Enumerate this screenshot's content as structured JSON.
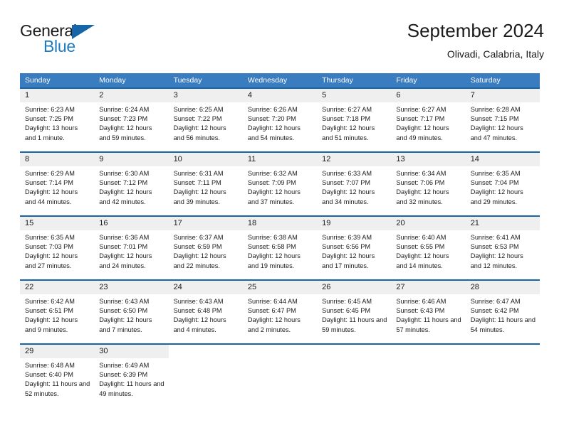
{
  "brand": {
    "name_part1": "General",
    "name_part2": "Blue",
    "logo_icon": "triangle-logo-icon",
    "accent_color": "#1565a8"
  },
  "header": {
    "title": "September 2024",
    "subtitle": "Olivadi, Calabria, Italy"
  },
  "colors": {
    "header_bar": "#3a7cc0",
    "cell_border_top": "#1565a8",
    "daynum_band": "#efefef",
    "text": "#1b1b1b",
    "brand_blue": "#1f7ac0"
  },
  "weekdays": [
    "Sunday",
    "Monday",
    "Tuesday",
    "Wednesday",
    "Thursday",
    "Friday",
    "Saturday"
  ],
  "weeks": [
    [
      {
        "day": "1",
        "sunrise": "Sunrise: 6:23 AM",
        "sunset": "Sunset: 7:25 PM",
        "daylight": "Daylight: 13 hours and 1 minute."
      },
      {
        "day": "2",
        "sunrise": "Sunrise: 6:24 AM",
        "sunset": "Sunset: 7:23 PM",
        "daylight": "Daylight: 12 hours and 59 minutes."
      },
      {
        "day": "3",
        "sunrise": "Sunrise: 6:25 AM",
        "sunset": "Sunset: 7:22 PM",
        "daylight": "Daylight: 12 hours and 56 minutes."
      },
      {
        "day": "4",
        "sunrise": "Sunrise: 6:26 AM",
        "sunset": "Sunset: 7:20 PM",
        "daylight": "Daylight: 12 hours and 54 minutes."
      },
      {
        "day": "5",
        "sunrise": "Sunrise: 6:27 AM",
        "sunset": "Sunset: 7:18 PM",
        "daylight": "Daylight: 12 hours and 51 minutes."
      },
      {
        "day": "6",
        "sunrise": "Sunrise: 6:27 AM",
        "sunset": "Sunset: 7:17 PM",
        "daylight": "Daylight: 12 hours and 49 minutes."
      },
      {
        "day": "7",
        "sunrise": "Sunrise: 6:28 AM",
        "sunset": "Sunset: 7:15 PM",
        "daylight": "Daylight: 12 hours and 47 minutes."
      }
    ],
    [
      {
        "day": "8",
        "sunrise": "Sunrise: 6:29 AM",
        "sunset": "Sunset: 7:14 PM",
        "daylight": "Daylight: 12 hours and 44 minutes."
      },
      {
        "day": "9",
        "sunrise": "Sunrise: 6:30 AM",
        "sunset": "Sunset: 7:12 PM",
        "daylight": "Daylight: 12 hours and 42 minutes."
      },
      {
        "day": "10",
        "sunrise": "Sunrise: 6:31 AM",
        "sunset": "Sunset: 7:11 PM",
        "daylight": "Daylight: 12 hours and 39 minutes."
      },
      {
        "day": "11",
        "sunrise": "Sunrise: 6:32 AM",
        "sunset": "Sunset: 7:09 PM",
        "daylight": "Daylight: 12 hours and 37 minutes."
      },
      {
        "day": "12",
        "sunrise": "Sunrise: 6:33 AM",
        "sunset": "Sunset: 7:07 PM",
        "daylight": "Daylight: 12 hours and 34 minutes."
      },
      {
        "day": "13",
        "sunrise": "Sunrise: 6:34 AM",
        "sunset": "Sunset: 7:06 PM",
        "daylight": "Daylight: 12 hours and 32 minutes."
      },
      {
        "day": "14",
        "sunrise": "Sunrise: 6:35 AM",
        "sunset": "Sunset: 7:04 PM",
        "daylight": "Daylight: 12 hours and 29 minutes."
      }
    ],
    [
      {
        "day": "15",
        "sunrise": "Sunrise: 6:35 AM",
        "sunset": "Sunset: 7:03 PM",
        "daylight": "Daylight: 12 hours and 27 minutes."
      },
      {
        "day": "16",
        "sunrise": "Sunrise: 6:36 AM",
        "sunset": "Sunset: 7:01 PM",
        "daylight": "Daylight: 12 hours and 24 minutes."
      },
      {
        "day": "17",
        "sunrise": "Sunrise: 6:37 AM",
        "sunset": "Sunset: 6:59 PM",
        "daylight": "Daylight: 12 hours and 22 minutes."
      },
      {
        "day": "18",
        "sunrise": "Sunrise: 6:38 AM",
        "sunset": "Sunset: 6:58 PM",
        "daylight": "Daylight: 12 hours and 19 minutes."
      },
      {
        "day": "19",
        "sunrise": "Sunrise: 6:39 AM",
        "sunset": "Sunset: 6:56 PM",
        "daylight": "Daylight: 12 hours and 17 minutes."
      },
      {
        "day": "20",
        "sunrise": "Sunrise: 6:40 AM",
        "sunset": "Sunset: 6:55 PM",
        "daylight": "Daylight: 12 hours and 14 minutes."
      },
      {
        "day": "21",
        "sunrise": "Sunrise: 6:41 AM",
        "sunset": "Sunset: 6:53 PM",
        "daylight": "Daylight: 12 hours and 12 minutes."
      }
    ],
    [
      {
        "day": "22",
        "sunrise": "Sunrise: 6:42 AM",
        "sunset": "Sunset: 6:51 PM",
        "daylight": "Daylight: 12 hours and 9 minutes."
      },
      {
        "day": "23",
        "sunrise": "Sunrise: 6:43 AM",
        "sunset": "Sunset: 6:50 PM",
        "daylight": "Daylight: 12 hours and 7 minutes."
      },
      {
        "day": "24",
        "sunrise": "Sunrise: 6:43 AM",
        "sunset": "Sunset: 6:48 PM",
        "daylight": "Daylight: 12 hours and 4 minutes."
      },
      {
        "day": "25",
        "sunrise": "Sunrise: 6:44 AM",
        "sunset": "Sunset: 6:47 PM",
        "daylight": "Daylight: 12 hours and 2 minutes."
      },
      {
        "day": "26",
        "sunrise": "Sunrise: 6:45 AM",
        "sunset": "Sunset: 6:45 PM",
        "daylight": "Daylight: 11 hours and 59 minutes."
      },
      {
        "day": "27",
        "sunrise": "Sunrise: 6:46 AM",
        "sunset": "Sunset: 6:43 PM",
        "daylight": "Daylight: 11 hours and 57 minutes."
      },
      {
        "day": "28",
        "sunrise": "Sunrise: 6:47 AM",
        "sunset": "Sunset: 6:42 PM",
        "daylight": "Daylight: 11 hours and 54 minutes."
      }
    ],
    [
      {
        "day": "29",
        "sunrise": "Sunrise: 6:48 AM",
        "sunset": "Sunset: 6:40 PM",
        "daylight": "Daylight: 11 hours and 52 minutes."
      },
      {
        "day": "30",
        "sunrise": "Sunrise: 6:49 AM",
        "sunset": "Sunset: 6:39 PM",
        "daylight": "Daylight: 11 hours and 49 minutes."
      },
      {
        "day": "",
        "sunrise": "",
        "sunset": "",
        "daylight": ""
      },
      {
        "day": "",
        "sunrise": "",
        "sunset": "",
        "daylight": ""
      },
      {
        "day": "",
        "sunrise": "",
        "sunset": "",
        "daylight": ""
      },
      {
        "day": "",
        "sunrise": "",
        "sunset": "",
        "daylight": ""
      },
      {
        "day": "",
        "sunrise": "",
        "sunset": "",
        "daylight": ""
      }
    ]
  ]
}
